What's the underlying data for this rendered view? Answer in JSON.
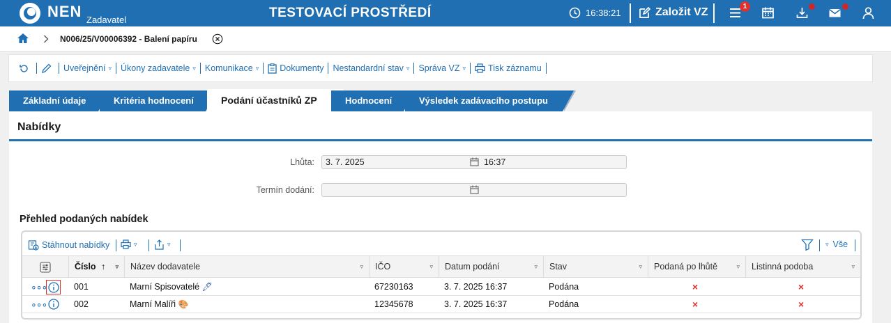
{
  "colors": {
    "brand": "#1f6fb2",
    "badge": "#e0322d",
    "reject": "#e0322d"
  },
  "header": {
    "logo_text": "NEN",
    "logo_sub": "Zadavatel",
    "env_title": "TESTOVACÍ PROSTŘEDÍ",
    "time": "16:38:21",
    "create_label": "Založit VZ",
    "menu_badge": "1",
    "icons": [
      "clock-icon",
      "edit-icon",
      "menu-icon",
      "calendar-icon",
      "download-icon",
      "mail-icon",
      "user-icon"
    ]
  },
  "breadcrumb": {
    "text": "N006/25/V00006392 - Balení papíru"
  },
  "toolbar": {
    "items": [
      {
        "label": "Uveřejnění",
        "caret": "▿"
      },
      {
        "label": "Úkony zadavatele",
        "caret": "▿"
      },
      {
        "label": "Komunikace",
        "caret": "▿"
      },
      {
        "label": "Dokumenty",
        "caret": ""
      },
      {
        "label": "Nestandardní stav",
        "caret": "▿"
      },
      {
        "label": "Správa VZ",
        "caret": "▿"
      },
      {
        "label": "Tisk záznamu",
        "caret": ""
      }
    ]
  },
  "tabs": [
    {
      "label": "Základní údaje"
    },
    {
      "label": "Kritéria hodnocení"
    },
    {
      "label": "Podání účastníků ZP"
    },
    {
      "label": "Hodnocení"
    },
    {
      "label": "Výsledek zadávacího postupu"
    }
  ],
  "panel": {
    "title": "Nabídky",
    "deadline_label": "Lhůta:",
    "deadline_date": "3. 7. 2025",
    "deadline_time": "16:37",
    "delivery_label": "Termín dodání:",
    "delivery_date": ""
  },
  "offers": {
    "title": "Přehled podaných nabídek",
    "download_label": "Stáhnout nabídky",
    "filter_all": "Vše",
    "columns": {
      "number": "Číslo",
      "supplier": "Název dodavatele",
      "ico": "IČO",
      "date": "Datum podání",
      "state": "Stav",
      "late": "Podaná po lhůtě",
      "paper": "Listinná podoba"
    },
    "rows": [
      {
        "number": "001",
        "supplier": "Marní Spisovatelé",
        "supplier_icon": "pen-icon",
        "ico": "67230163",
        "date": "3. 7. 2025 16:37",
        "state": "Podána",
        "late": "×",
        "paper": "×"
      },
      {
        "number": "002",
        "supplier": "Marní Malíři",
        "supplier_icon": "palette-icon",
        "ico": "12345678",
        "date": "3. 7. 2025 16:37",
        "state": "Podána",
        "late": "×",
        "paper": "×"
      }
    ]
  }
}
